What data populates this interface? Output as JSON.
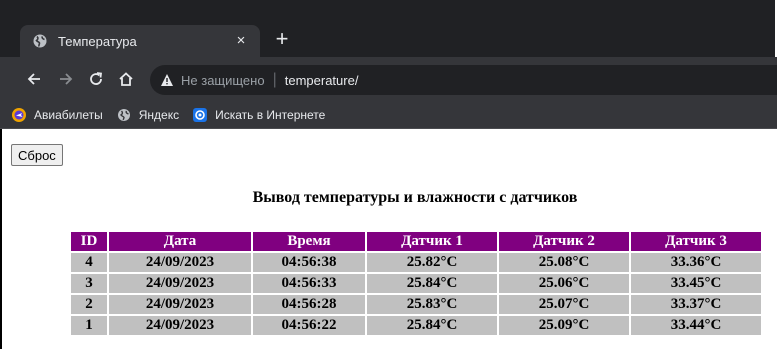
{
  "browser": {
    "tab": {
      "title": "Температура",
      "close_glyph": "×",
      "favicon": "globe-icon"
    },
    "new_tab_glyph": "+",
    "nav": {
      "back": "arrow-left-icon",
      "forward": "arrow-right-icon",
      "reload": "reload-icon",
      "home": "home-icon"
    },
    "omnibox": {
      "security_label": "Не защищено",
      "separator": "|",
      "url": "temperature/"
    },
    "bookmarks": [
      {
        "label": "Авиабилеты",
        "icon": "plane-icon"
      },
      {
        "label": "Яндекс",
        "icon": "globe-icon"
      },
      {
        "label": "Искать в Интернете",
        "icon": "search-engine-icon"
      }
    ]
  },
  "page": {
    "reset_label": "Сброс",
    "heading": "Вывод температуры и влажности с датчиков",
    "table": {
      "headers": [
        "ID",
        "Дата",
        "Время",
        "Датчик 1",
        "Датчик 2",
        "Датчик 3"
      ],
      "rows": [
        [
          "4",
          "24/09/2023",
          "04:56:38",
          "25.82°C",
          "25.08°C",
          "33.36°C"
        ],
        [
          "3",
          "24/09/2023",
          "04:56:33",
          "25.84°C",
          "25.06°C",
          "33.45°C"
        ],
        [
          "2",
          "24/09/2023",
          "04:56:28",
          "25.83°C",
          "25.07°C",
          "33.37°C"
        ],
        [
          "1",
          "24/09/2023",
          "04:56:22",
          "25.84°C",
          "25.09°C",
          "33.44°C"
        ]
      ]
    }
  },
  "colors": {
    "header_bg": "#800080",
    "cell_bg": "#c0c0c0",
    "chrome_dark": "#202124",
    "chrome_toolbar": "#35363a"
  }
}
